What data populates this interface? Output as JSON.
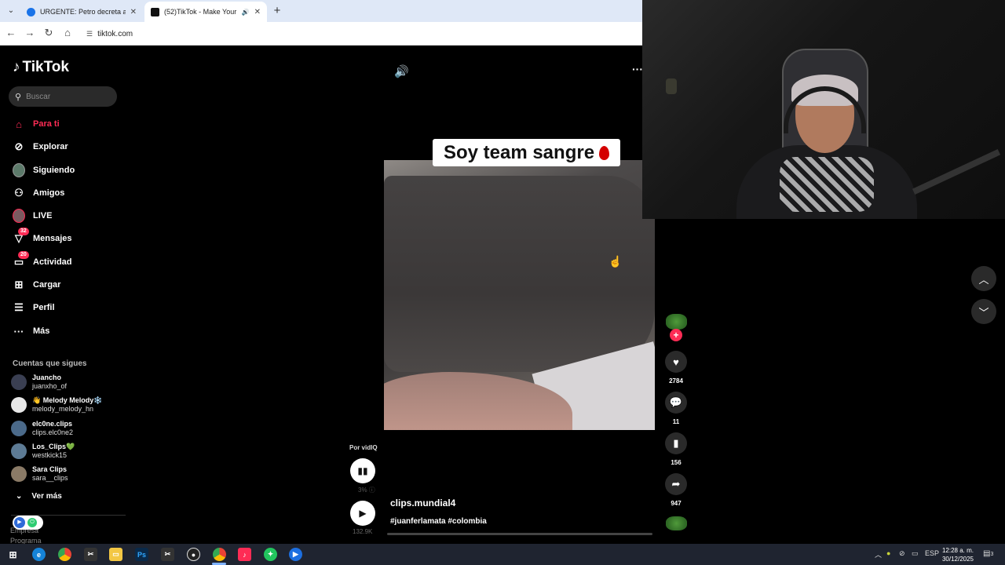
{
  "browser": {
    "tabs": [
      {
        "title": "URGENTE: Petro decreta alza de",
        "close": "✕"
      },
      {
        "title": "(52)TikTok - Make Your Day",
        "close": "✕"
      }
    ],
    "new_tab": "+",
    "url": "tiktok.com"
  },
  "tiktok": {
    "logo": "TikTok",
    "search_placeholder": "Buscar",
    "menu": [
      {
        "label": "Para ti",
        "icon": "home-icon",
        "active": true
      },
      {
        "label": "Explorar",
        "icon": "compass-icon"
      },
      {
        "label": "Siguiendo",
        "icon": "avatar-icon"
      },
      {
        "label": "Amigos",
        "icon": "friends-icon"
      },
      {
        "label": "LIVE",
        "icon": "live-avatar-icon"
      },
      {
        "label": "Mensajes",
        "icon": "messages-icon",
        "badge": "32"
      },
      {
        "label": "Actividad",
        "icon": "activity-icon",
        "badge": "20"
      },
      {
        "label": "Cargar",
        "icon": "upload-icon"
      },
      {
        "label": "Perfil",
        "icon": "profile-icon"
      },
      {
        "label": "Más",
        "icon": "more-icon"
      }
    ],
    "following_title": "Cuentas que sigues",
    "following": [
      {
        "name": "Juancho",
        "handle": "juanxho_of"
      },
      {
        "name": "👋 Melody Melody❄️",
        "handle": "melody_melody_hn"
      },
      {
        "name": "elc0ne.clips",
        "handle": "clips.elc0ne2"
      },
      {
        "name": "Los_Clips💚",
        "handle": "westkick15"
      },
      {
        "name": "Sara Clips",
        "handle": "sara__clips"
      }
    ],
    "ver_mas": "Ver más",
    "footer_1": "Empresa",
    "footer_2": "Programa"
  },
  "video": {
    "caption": "Soy team sangre",
    "author": "clips.mundial4",
    "hashtags": "#juanferlamata #colombia",
    "vidiq_label": "Por vidIQ",
    "vidiq_pct": "3%",
    "views": "132.9K",
    "likes": "2784",
    "comments": "11",
    "saves": "156",
    "shares": "947"
  },
  "taskbar": {
    "lang": "ESP",
    "time": "12:28 a. m.",
    "date": "30/12/2025",
    "notif": "3"
  }
}
